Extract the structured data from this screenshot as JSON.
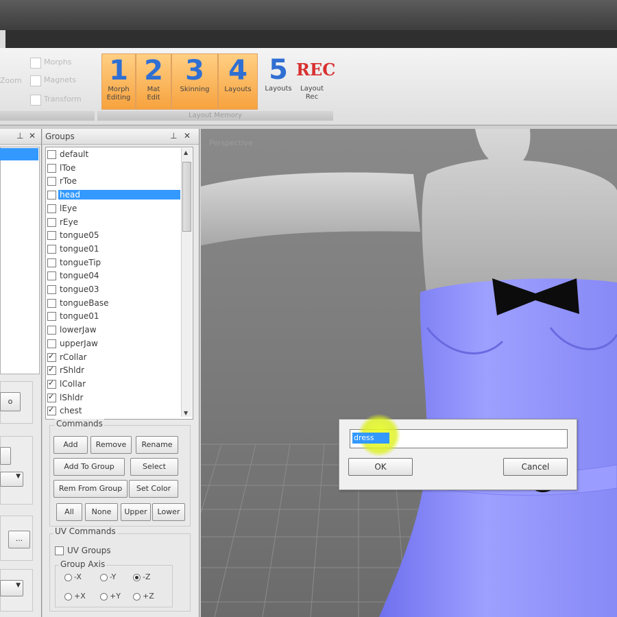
{
  "window": {
    "title_text": ""
  },
  "ribbon": {
    "checkboxes": [
      {
        "label": "Morphs"
      },
      {
        "label": "Magnets"
      },
      {
        "label": "Transform"
      }
    ],
    "left_group_label": "Zoom",
    "buttons": [
      {
        "number": "1",
        "label_line1": "Morph",
        "label_line2": "Editing"
      },
      {
        "number": "2",
        "label_line1": "Mat",
        "label_line2": "Edit"
      },
      {
        "number": "3",
        "label_line1": "Skinning",
        "label_line2": ""
      },
      {
        "number": "4",
        "label_line1": "Layouts",
        "label_line2": ""
      },
      {
        "number": "5",
        "label_line1": "Layouts",
        "label_line2": ""
      },
      {
        "number": "REC",
        "label_line1": "Layout",
        "label_line2": "Rec"
      }
    ],
    "group_footer": "Layout Memory"
  },
  "groups_panel": {
    "title": "Groups",
    "pin": "⊥",
    "close": "✕",
    "items": [
      {
        "label": "default",
        "checked": false,
        "selected": false
      },
      {
        "label": "lToe",
        "checked": false,
        "selected": false
      },
      {
        "label": "rToe",
        "checked": false,
        "selected": false
      },
      {
        "label": "head",
        "checked": false,
        "selected": true
      },
      {
        "label": "lEye",
        "checked": false,
        "selected": false
      },
      {
        "label": "rEye",
        "checked": false,
        "selected": false
      },
      {
        "label": "tongue05",
        "checked": false,
        "selected": false
      },
      {
        "label": "tongue01",
        "checked": false,
        "selected": false
      },
      {
        "label": "tongueTip",
        "checked": false,
        "selected": false
      },
      {
        "label": "tongue04",
        "checked": false,
        "selected": false
      },
      {
        "label": "tongue03",
        "checked": false,
        "selected": false
      },
      {
        "label": "tongueBase",
        "checked": false,
        "selected": false
      },
      {
        "label": "tongue01",
        "checked": false,
        "selected": false
      },
      {
        "label": "lowerJaw",
        "checked": false,
        "selected": false
      },
      {
        "label": "upperJaw",
        "checked": false,
        "selected": false
      },
      {
        "label": "rCollar",
        "checked": true,
        "selected": false
      },
      {
        "label": "rShldr",
        "checked": true,
        "selected": false
      },
      {
        "label": "lCollar",
        "checked": true,
        "selected": false
      },
      {
        "label": "lShldr",
        "checked": true,
        "selected": false
      },
      {
        "label": "chest",
        "checked": true,
        "selected": false
      }
    ],
    "commands_legend": "Commands",
    "commands": {
      "add": "Add",
      "remove": "Remove",
      "rename": "Rename",
      "add_to_group": "Add To Group",
      "select": "Select",
      "rem_from_group": "Rem From Group",
      "set_color": "Set Color",
      "all": "All",
      "none": "None",
      "upper": "Upper",
      "lower": "Lower"
    },
    "uv_legend": "UV Commands",
    "uv_groups_label": "UV Groups",
    "group_axis_legend": "Group Axis",
    "axis_row1": [
      "-X",
      "-Y",
      "-Z"
    ],
    "axis_row2": [
      "+X",
      "+Y",
      "+Z"
    ]
  },
  "left_panel": {
    "pin": "⊥",
    "close": "✕",
    "button_dots": "..."
  },
  "viewport": {
    "label": "Perspective"
  },
  "dialog": {
    "input_value": "dress",
    "ok_label": "OK",
    "cancel_label": "Cancel"
  }
}
